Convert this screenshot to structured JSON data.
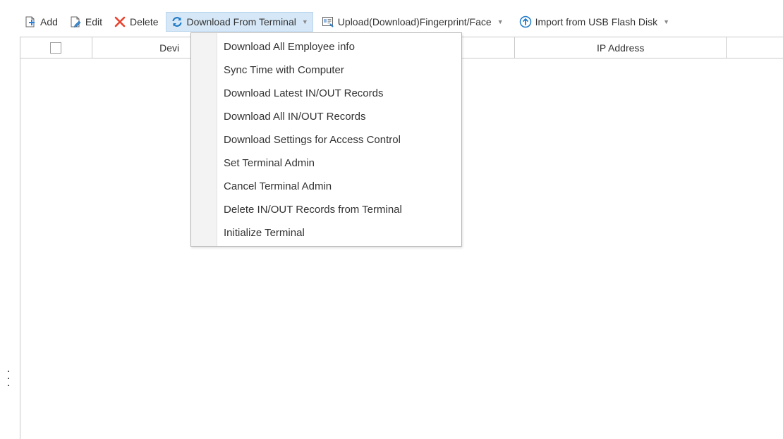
{
  "toolbar": {
    "add_label": "Add",
    "edit_label": "Edit",
    "delete_label": "Delete",
    "download_label": "Download From Terminal",
    "upload_label": "Upload(Download)Fingerprint/Face",
    "import_label": "Import from USB Flash Disk"
  },
  "table": {
    "columns": [
      "",
      "Devi",
      "IP Address",
      ""
    ]
  },
  "download_menu": {
    "items": [
      "Download All Employee info",
      "Sync Time with Computer",
      "Download Latest IN/OUT Records",
      "Download All IN/OUT Records",
      "Download Settings for Access Control",
      "Set Terminal Admin",
      "Cancel Terminal Admin",
      "Delete IN/OUT Records from Terminal",
      "Initialize Terminal"
    ]
  },
  "colors": {
    "active_button_bg": "#d6e8f7",
    "delete_icon": "#e8412c",
    "grid_border": "#c9c9c9",
    "menu_gutter": "#f3f3f3"
  },
  "icons": [
    "add-icon",
    "edit-icon",
    "delete-icon",
    "sync-icon",
    "caret-down-icon",
    "upload-icon",
    "import-icon",
    "caret-down-icon"
  ]
}
